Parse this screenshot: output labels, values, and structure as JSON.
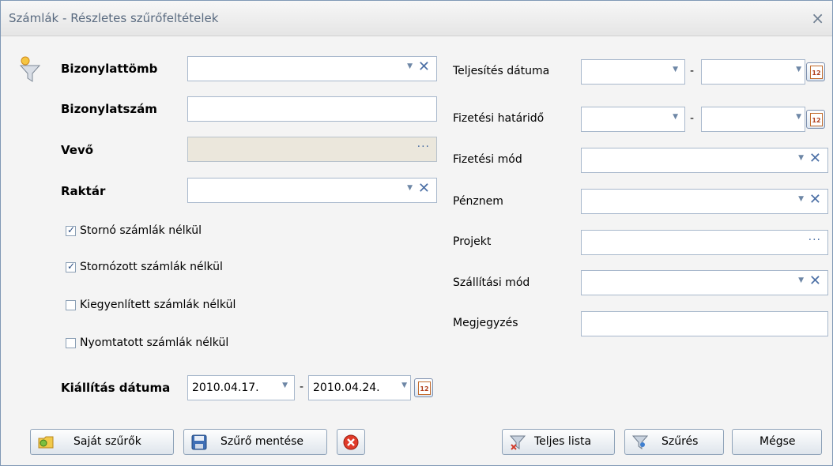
{
  "window": {
    "title": "Számlák - Részletes szűrőfeltételek",
    "close_glyph": "×"
  },
  "left": {
    "bizonylattomb_label": "Bizonylattömb",
    "bizonylatszam_label": "Bizonylatszám",
    "vevo_label": "Vevő",
    "raktar_label": "Raktár",
    "checkboxes": [
      {
        "label": "Stornó számlák nélkül",
        "checked": true
      },
      {
        "label": "Stornózott számlák nélkül",
        "checked": true
      },
      {
        "label": "Kiegyenlített számlák nélkül",
        "checked": false
      },
      {
        "label": "Nyomtatott számlák nélkül",
        "checked": false
      }
    ],
    "kiallitas_label": "Kiállítás dátuma",
    "kiallitas_from": "2010.04.17.",
    "kiallitas_to": "2010.04.24.",
    "dash": "-"
  },
  "right": {
    "teljesites_label": "Teljesítés dátuma",
    "fizetesi_hatarido_label": "Fizetési határidő",
    "fizetesi_mod_label": "Fizetési mód",
    "penznem_label": "Pénznem",
    "projekt_label": "Projekt",
    "szallitasi_mod_label": "Szállítási mód",
    "megjegyzes_label": "Megjegyzés",
    "dash": "-"
  },
  "glyphs": {
    "dropdown": "▼",
    "clear": "✕",
    "ellipsis": "···",
    "calendar_day": "12"
  },
  "buttons": {
    "sajat_szurok": "Saját szűrők",
    "szuro_mentese": "Szűrő mentése",
    "teljes_lista": "Teljes lista",
    "szures": "Szűrés",
    "megse": "Mégse"
  },
  "icons": [
    "filter-icon",
    "folder-icon",
    "save-icon",
    "delete-icon",
    "funnel-clear-icon",
    "funnel-icon",
    "calendar-icon"
  ],
  "colors": {
    "accent_blue": "#4b6fa5",
    "border": "#a8b8cc",
    "disabled_bg": "#ebe7dc"
  }
}
